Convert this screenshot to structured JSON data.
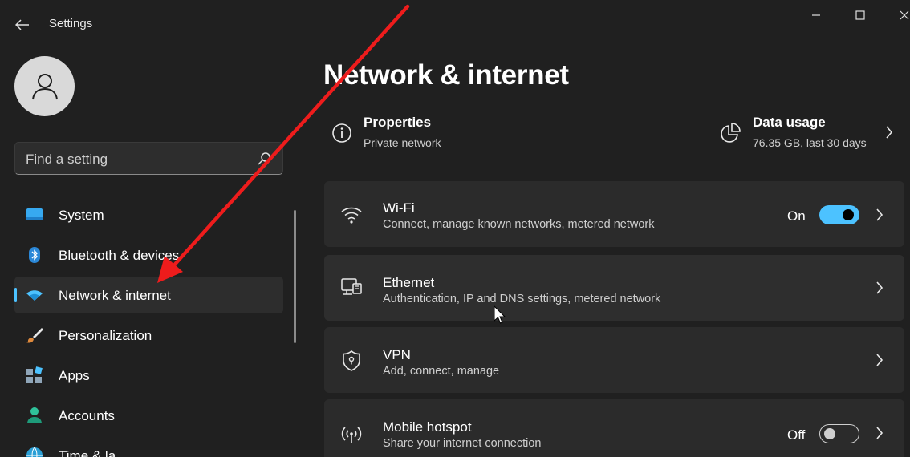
{
  "window": {
    "title": "Settings",
    "controls": [
      "minimize-icon",
      "maximize-icon",
      "close-icon"
    ]
  },
  "search": {
    "placeholder": "Find a setting"
  },
  "sidebar": {
    "items": [
      {
        "label": "System",
        "icon": "system-icon"
      },
      {
        "label": "Bluetooth & devices",
        "icon": "bluetooth-icon"
      },
      {
        "label": "Network & internet",
        "icon": "wifi-icon",
        "selected": true
      },
      {
        "label": "Personalization",
        "icon": "brush-icon"
      },
      {
        "label": "Apps",
        "icon": "apps-icon"
      },
      {
        "label": "Accounts",
        "icon": "person-icon"
      },
      {
        "label": "Time & la",
        "icon": "globe-icon"
      }
    ]
  },
  "main": {
    "title": "Network & internet",
    "properties": {
      "title": "Properties",
      "subtitle": "Private network"
    },
    "data_usage": {
      "title": "Data usage",
      "subtitle": "76.35 GB, last 30 days"
    },
    "cards": [
      {
        "title": "Wi-Fi",
        "subtitle": "Connect, manage known networks, metered network",
        "toggle_label": "On",
        "toggle_on": true,
        "icon": "wifi-icon"
      },
      {
        "title": "Ethernet",
        "subtitle": "Authentication, IP and DNS settings, metered network",
        "icon": "ethernet-icon"
      },
      {
        "title": "VPN",
        "subtitle": "Add, connect, manage",
        "icon": "shield-icon"
      },
      {
        "title": "Mobile hotspot",
        "subtitle": "Share your internet connection",
        "toggle_label": "Off",
        "toggle_on": false,
        "icon": "hotspot-icon"
      }
    ]
  },
  "colors": {
    "background": "#202020",
    "card": "#2b2b2b",
    "accent": "#4cc2ff",
    "annotation_arrow": "#ee1c1c"
  }
}
